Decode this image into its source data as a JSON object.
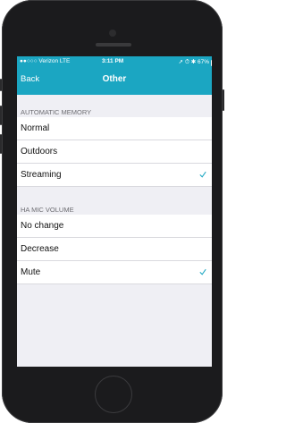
{
  "status_bar": {
    "carrier": "●●○○○ Verizon  LTE",
    "time": "3:11 PM",
    "right": "➚ ⏱ ✱ 67%"
  },
  "nav": {
    "back_label": "Back",
    "title": "Other"
  },
  "sections": [
    {
      "header": "AUTOMATIC MEMORY",
      "items": [
        {
          "label": "Normal",
          "checked": false
        },
        {
          "label": "Outdoors",
          "checked": false
        },
        {
          "label": "Streaming",
          "checked": true
        }
      ]
    },
    {
      "header": "HA MIC VOLUME",
      "items": [
        {
          "label": "No change",
          "checked": false
        },
        {
          "label": "Decrease",
          "checked": false
        },
        {
          "label": "Mute",
          "checked": true
        }
      ]
    }
  ],
  "colors": {
    "accent": "#1ba6c2",
    "background": "#efeff4"
  }
}
